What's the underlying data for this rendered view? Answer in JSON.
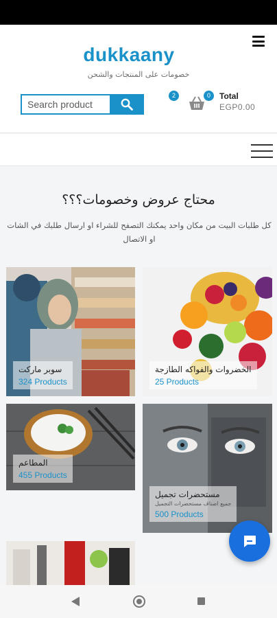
{
  "header": {
    "logo": "dukkaany",
    "tagline": "خصومات على المنتجات والشحن",
    "search_placeholder": "Search product",
    "wishlist_count": "2",
    "cart_count": "0",
    "total_label": "Total",
    "total_value": "EGP0.00"
  },
  "intro": {
    "heading": "محتاج عروض وخصومات؟؟؟",
    "text": "كل طلبات البيت من مكان واحد يمكنك التصفح للشراء او ارسال طلبك في الشات او الاتصال"
  },
  "categories": [
    {
      "title": "سوبر ماركت",
      "count": "324 Products"
    },
    {
      "title": "الخضروات والفواكه الطازجة",
      "count": "25 Products"
    },
    {
      "title": "المطاعم",
      "count": "455 Products"
    },
    {
      "title": "مستحضرات تجميل",
      "description": "جميع اصناف مستحضرات التجميل",
      "count": "500 Products"
    }
  ],
  "colors": {
    "accent": "#1a91c9",
    "chat": "#1a6fde"
  },
  "icons": [
    "menu-icon",
    "search-icon",
    "cart-icon",
    "chat-icon",
    "back-icon",
    "home-icon",
    "recents-icon"
  ]
}
